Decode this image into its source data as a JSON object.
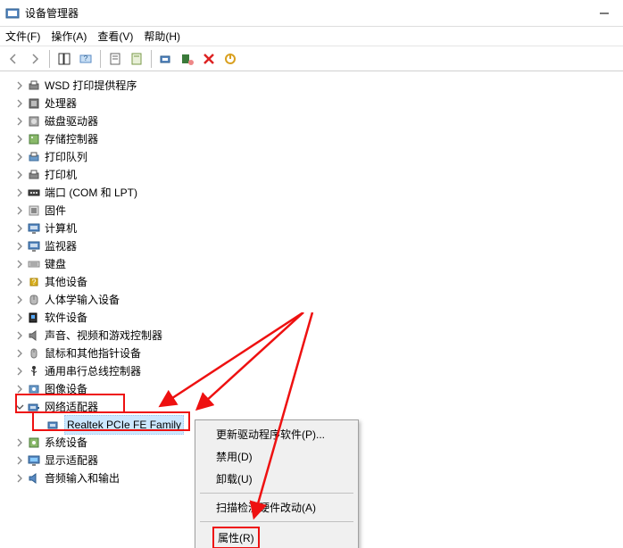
{
  "window": {
    "title": "设备管理器"
  },
  "menu": {
    "file": "文件(F)",
    "action": "操作(A)",
    "view": "查看(V)",
    "help": "帮助(H)"
  },
  "tree": {
    "items": [
      {
        "label": "WSD 打印提供程序",
        "icon": "printer"
      },
      {
        "label": "处理器",
        "icon": "cpu"
      },
      {
        "label": "磁盘驱动器",
        "icon": "disk"
      },
      {
        "label": "存储控制器",
        "icon": "storage"
      },
      {
        "label": "打印队列",
        "icon": "printqueue"
      },
      {
        "label": "打印机",
        "icon": "printer2"
      },
      {
        "label": "端口 (COM 和 LPT)",
        "icon": "port"
      },
      {
        "label": "固件",
        "icon": "firmware"
      },
      {
        "label": "计算机",
        "icon": "computer"
      },
      {
        "label": "监视器",
        "icon": "monitor"
      },
      {
        "label": "键盘",
        "icon": "keyboard"
      },
      {
        "label": "其他设备",
        "icon": "other"
      },
      {
        "label": "人体学输入设备",
        "icon": "hid"
      },
      {
        "label": "软件设备",
        "icon": "software"
      },
      {
        "label": "声音、视频和游戏控制器",
        "icon": "sound"
      },
      {
        "label": "鼠标和其他指针设备",
        "icon": "mouse"
      },
      {
        "label": "通用串行总线控制器",
        "icon": "usb"
      },
      {
        "label": "图像设备",
        "icon": "image"
      }
    ],
    "network": {
      "label": "网络适配器",
      "child": "Realtek PCIe FE Family"
    },
    "after": [
      {
        "label": "系统设备",
        "icon": "system"
      },
      {
        "label": "显示适配器",
        "icon": "display"
      },
      {
        "label": "音频输入和输出",
        "icon": "audio"
      }
    ]
  },
  "context": {
    "update": "更新驱动程序软件(P)...",
    "disable": "禁用(D)",
    "uninstall": "卸载(U)",
    "scan": "扫描检测硬件改动(A)",
    "props": "属性(R)"
  }
}
